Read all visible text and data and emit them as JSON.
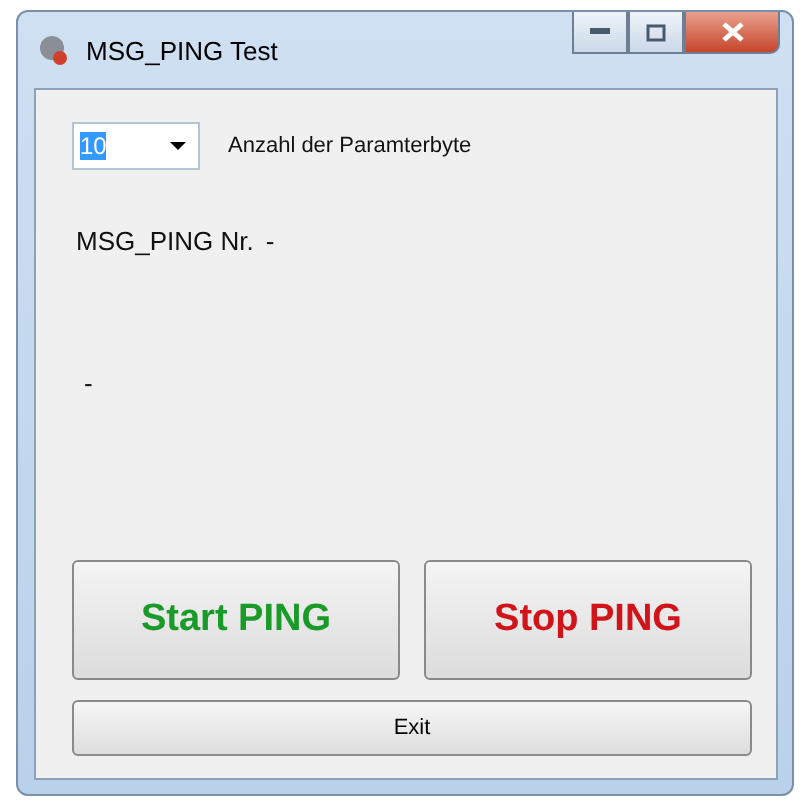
{
  "window": {
    "title": "MSG_PING Test"
  },
  "byte_count": {
    "value": "10",
    "label": "Anzahl der Paramterbyte"
  },
  "ping_number": {
    "label": "MSG_PING Nr.",
    "value": "-"
  },
  "status": "-",
  "buttons": [
    {
      "label": "Start PING",
      "color": "#1a9a28"
    },
    {
      "label": "Stop PING",
      "color": "#d0141a"
    }
  ],
  "exit_button": "Exit"
}
